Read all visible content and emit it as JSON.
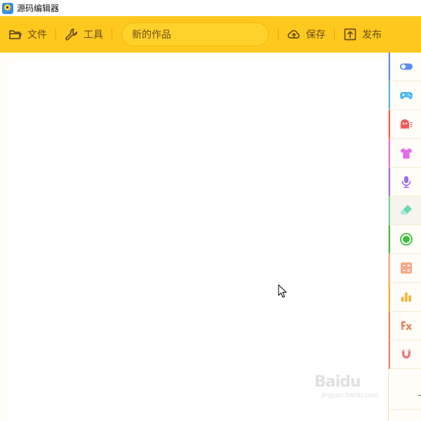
{
  "window": {
    "title": "源码编辑器"
  },
  "toolbar": {
    "file_label": "文件",
    "tools_label": "工具",
    "project_title": "新的作品",
    "save_label": "保存",
    "publish_label": "发布",
    "accent_color": "#ffc81e"
  },
  "categories": [
    {
      "name": "control",
      "icon": "toggle-icon",
      "color": "#5b8def"
    },
    {
      "name": "events",
      "icon": "gamepad-icon",
      "color": "#4fb8f0"
    },
    {
      "name": "actors",
      "icon": "ghost-icon",
      "color": "#f25b5b"
    },
    {
      "name": "appearance",
      "icon": "tshirt-icon",
      "color": "#e26ee8"
    },
    {
      "name": "sound",
      "icon": "microphone-icon",
      "color": "#9d6af0"
    },
    {
      "name": "pen",
      "icon": "highlighter-icon",
      "color": "#6ad8b4"
    },
    {
      "name": "detect",
      "icon": "radio-icon",
      "color": "#3dbf3d"
    },
    {
      "name": "operators",
      "icon": "calculator-icon",
      "color": "#f7a98a"
    },
    {
      "name": "data",
      "icon": "bar-chart-icon",
      "color": "#f4b22d"
    },
    {
      "name": "functions",
      "icon": "function-icon",
      "color": "#e9835a"
    },
    {
      "name": "physics",
      "icon": "magnet-icon",
      "color": "#e97c7c"
    }
  ],
  "watermark": {
    "logo": "Baidu",
    "url": "jingyan.baidu.com"
  }
}
